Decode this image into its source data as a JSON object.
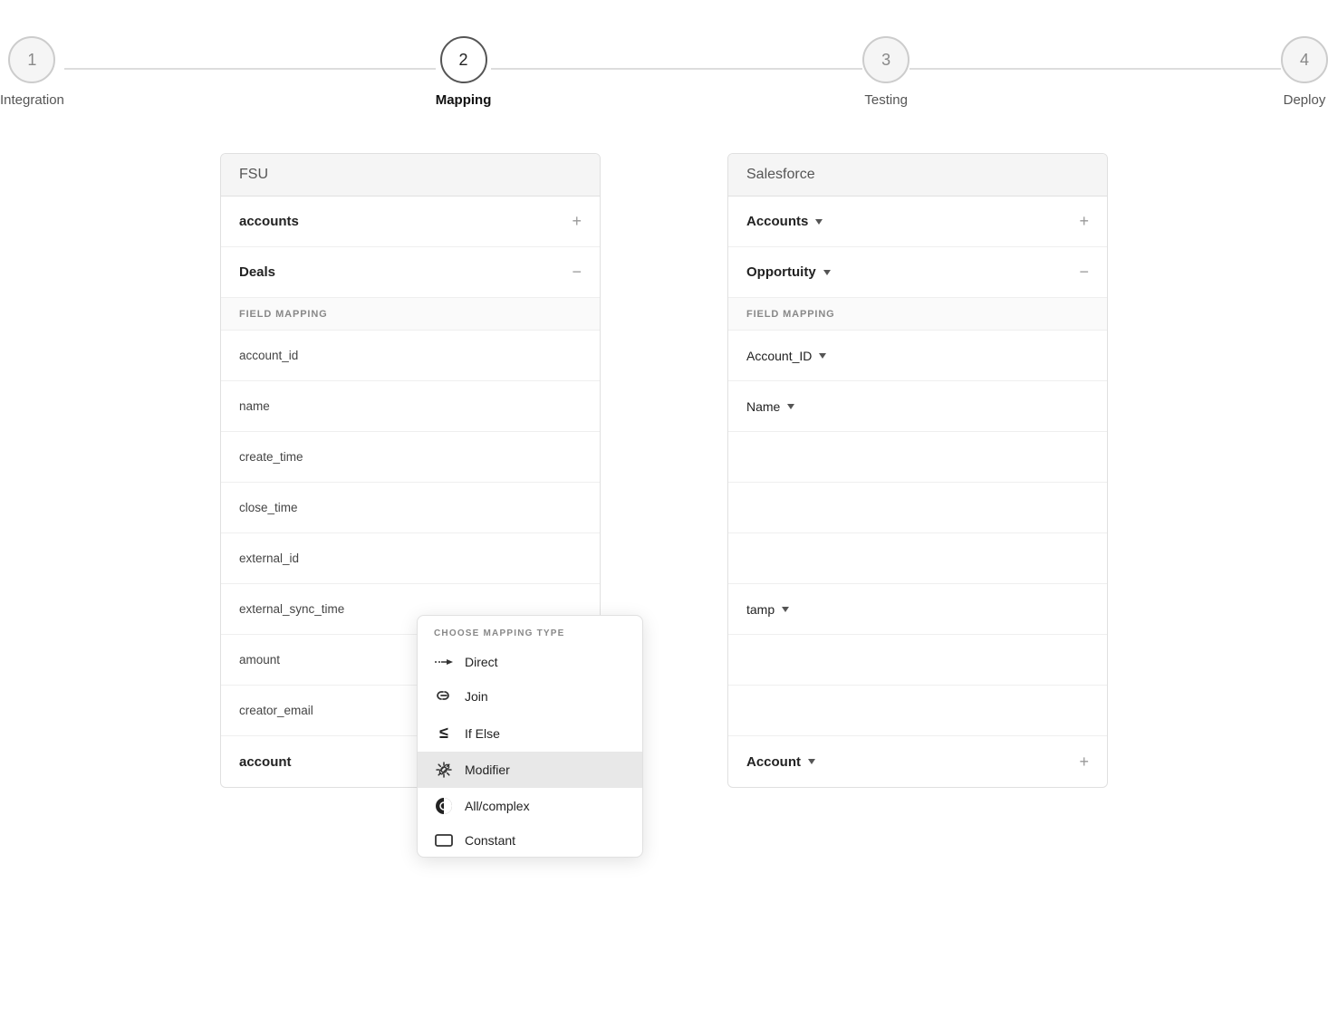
{
  "stepper": {
    "steps": [
      {
        "number": "1",
        "label": "Integration",
        "active": false
      },
      {
        "number": "2",
        "label": "Mapping",
        "active": true
      },
      {
        "number": "3",
        "label": "Testing",
        "active": false
      },
      {
        "number": "4",
        "label": "Deploy",
        "active": false
      }
    ]
  },
  "fsu_panel": {
    "header": "FSU",
    "rows": [
      {
        "type": "group",
        "label": "accounts",
        "action": "+"
      },
      {
        "type": "group",
        "label": "Deals",
        "action": "−"
      },
      {
        "type": "section",
        "label": "FIELD MAPPING"
      },
      {
        "type": "field",
        "label": "account_id"
      },
      {
        "type": "field",
        "label": "name"
      },
      {
        "type": "field",
        "label": "create_time"
      },
      {
        "type": "field",
        "label": "close_time"
      },
      {
        "type": "field",
        "label": "external_id"
      },
      {
        "type": "field",
        "label": "external_sync_time"
      },
      {
        "type": "field",
        "label": "amount"
      },
      {
        "type": "field",
        "label": "creator_email"
      },
      {
        "type": "group",
        "label": "account",
        "action": "+"
      }
    ]
  },
  "sf_panel": {
    "header": "Salesforce",
    "rows": [
      {
        "type": "group",
        "label": "Accounts",
        "dropdown": true,
        "action": "+"
      },
      {
        "type": "group",
        "label": "Opportuity",
        "dropdown": true,
        "action": "−"
      },
      {
        "type": "section",
        "label": "FIELD MAPPING"
      },
      {
        "type": "field",
        "label": "Account_ID",
        "dropdown": true
      },
      {
        "type": "field",
        "label": "Name",
        "dropdown": true
      },
      {
        "type": "field",
        "label": "",
        "dropdown": false
      },
      {
        "type": "field",
        "label": "",
        "dropdown": false
      },
      {
        "type": "field",
        "label": "",
        "dropdown": false
      },
      {
        "type": "field",
        "label": "tamp",
        "dropdown": true
      },
      {
        "type": "field",
        "label": "",
        "dropdown": false
      },
      {
        "type": "field",
        "label": "",
        "dropdown": false
      },
      {
        "type": "group",
        "label": "Account",
        "dropdown": true,
        "action": "+"
      }
    ]
  },
  "popup": {
    "title": "CHOOSE MAPPING TYPE",
    "items": [
      {
        "icon": "→",
        "label": "Direct",
        "active": false,
        "iconType": "arrow"
      },
      {
        "icon": "🔗",
        "label": "Join",
        "active": false,
        "iconType": "link"
      },
      {
        "icon": "≤",
        "label": "If Else",
        "active": false,
        "iconType": "ifelse"
      },
      {
        "icon": "✦",
        "label": "Modifier",
        "active": true,
        "iconType": "modifier"
      },
      {
        "icon": "◑",
        "label": "All/complex",
        "active": false,
        "iconType": "complex"
      },
      {
        "icon": "▭",
        "label": "Constant",
        "active": false,
        "iconType": "constant"
      }
    ]
  }
}
